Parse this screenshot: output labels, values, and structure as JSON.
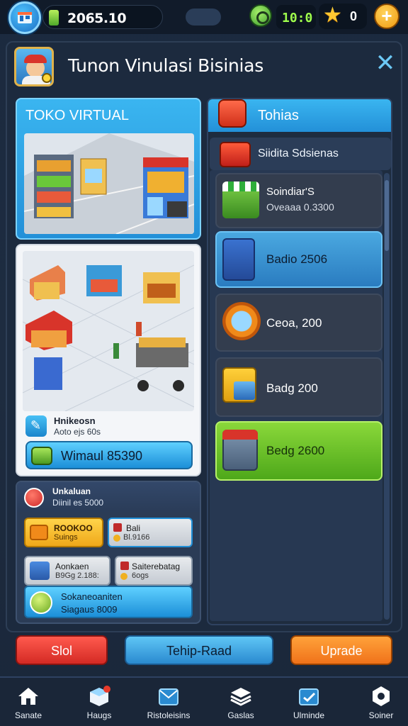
{
  "topbar": {
    "coins": "2065.10",
    "timer": "10:0",
    "stars": "0",
    "plus_label": "+"
  },
  "header": {
    "title": "Tunon Vinulasi Bisinias",
    "close_label": "✕"
  },
  "left": {
    "toko_label": "TOKO VIRTUAL",
    "map_card": {
      "info_title": "Hnikeosn",
      "info_sub": "Aoto ejs 60s",
      "button_label": "Wimaul 85390"
    },
    "stats": {
      "title": "Unkaluan",
      "subtitle": "Diinil es 5000",
      "tiles": [
        {
          "title": "ROOKOO",
          "sub": "Suings"
        },
        {
          "title": "Bali",
          "sub": "Bl.9166"
        },
        {
          "title": "Aonkaen",
          "sub": "B9Gg 2.188:"
        },
        {
          "title": "Saiterebatag",
          "sub": "6ogs"
        },
        {
          "title": "Sokaneoaniten",
          "sub": "Siagaus 8009"
        }
      ]
    }
  },
  "right": {
    "header_label": "Tohias",
    "sub_label": "Siidita Sdsienas",
    "items": [
      {
        "title": "Soindiar'S",
        "sub": "Oveaaa 0.3300"
      },
      {
        "title": "Badio 2506"
      },
      {
        "title": "Ceoa, 200"
      },
      {
        "title": "Badg 200"
      },
      {
        "title": "Bedg 2600"
      }
    ]
  },
  "actions": {
    "sell": "Slol",
    "tech": "Tehip-Raad",
    "upgrade": "Uprade"
  },
  "bottom_nav": [
    {
      "label": "Sanate",
      "icon": "home-icon"
    },
    {
      "label": "Haugs",
      "icon": "box-icon"
    },
    {
      "label": "Ristoleisins",
      "icon": "mail-icon"
    },
    {
      "label": "Gaslas",
      "icon": "stack-icon"
    },
    {
      "label": "Ulminde",
      "icon": "card-icon"
    },
    {
      "label": "Soiner",
      "icon": "gear-icon"
    }
  ],
  "colors": {
    "accent_blue": "#2a9ae0",
    "sell_red": "#d42a24",
    "upgrade_orange": "#f0721a",
    "selected_green": "#6ac82a",
    "background": "#1c2a3e"
  }
}
